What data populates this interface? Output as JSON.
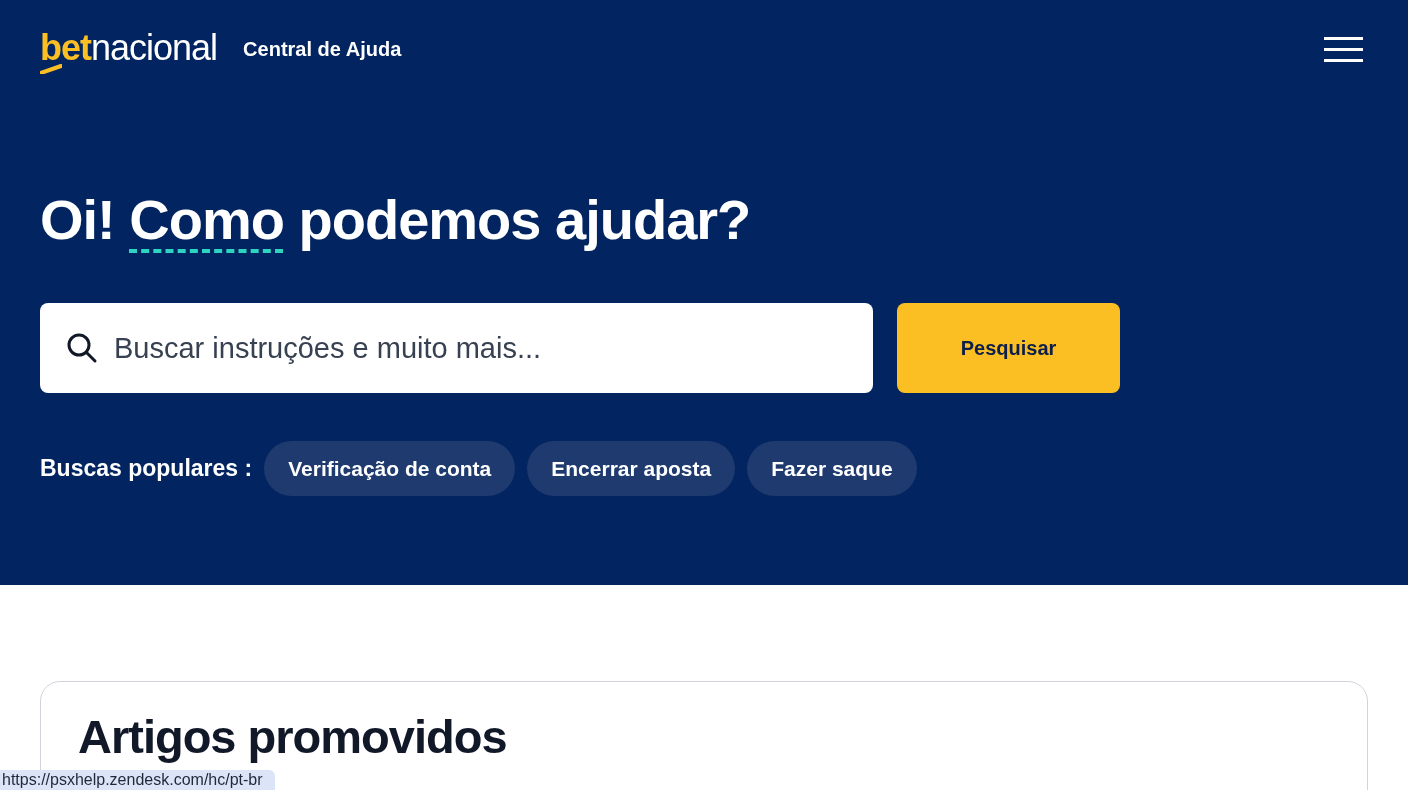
{
  "header": {
    "logo": {
      "accent": "bet",
      "rest": "nacional"
    },
    "title": "Central de Ajuda"
  },
  "hero": {
    "heading": {
      "before": "Oi!",
      "underlined": "Como",
      "after": "podemos ajudar?"
    },
    "search": {
      "placeholder": "Buscar instruções e muito mais...",
      "button": "Pesquisar"
    },
    "popular": {
      "label": "Buscas populares :",
      "items": [
        "Verificação de conta",
        "Encerrar aposta",
        "Fazer saque"
      ]
    }
  },
  "promoted": {
    "title": "Artigos promovidos"
  },
  "status_bar": {
    "url": "https://psxhelp.zendesk.com/hc/pt-br"
  }
}
